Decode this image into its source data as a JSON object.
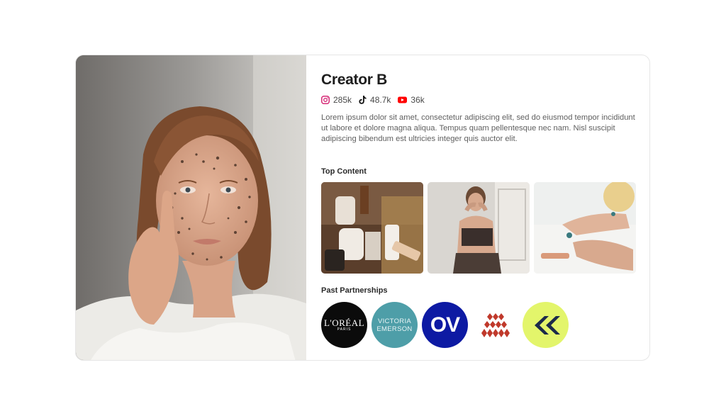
{
  "creator": {
    "name": "Creator B",
    "stats": [
      {
        "platform": "instagram",
        "icon": "instagram-icon",
        "value": "285k",
        "color": "#d62976"
      },
      {
        "platform": "tiktok",
        "icon": "tiktok-icon",
        "value": "48.7k",
        "color": "#111111"
      },
      {
        "platform": "youtube",
        "icon": "youtube-icon",
        "value": "36k",
        "color": "#ff0000"
      }
    ],
    "bio": "Lorem ipsum dolor sit amet, consectetur adipiscing elit, sed do eiusmod tempor incididunt ut labore et dolore magna aliqua. Tempus quam pellentesque nec nam. Nisl suscipit adipiscing bibendum est ultricies integer quis auctor elit."
  },
  "top_content": {
    "title": "Top Content",
    "items": [
      {
        "name": "skincare-products-photo"
      },
      {
        "name": "applying-skincare-photo"
      },
      {
        "name": "lotion-hands-photo"
      }
    ]
  },
  "partnerships": {
    "title": "Past Partnerships",
    "brands": [
      {
        "name": "loreal",
        "text": "L'ORÉAL",
        "sub": "PARIS",
        "bg": "#0b0b0b"
      },
      {
        "name": "victoria-emerson",
        "line1": "VICTORIA",
        "line2": "EMERSON",
        "bg": "#4e9ea8"
      },
      {
        "name": "ov",
        "text": "OV",
        "bg": "#0d1aa3"
      },
      {
        "name": "diamond-logo",
        "bg": "#ffffff",
        "accent": "#c0392b"
      },
      {
        "name": "chevron-logo",
        "bg": "#e3f56b",
        "accent": "#1b2a4a"
      }
    ]
  }
}
